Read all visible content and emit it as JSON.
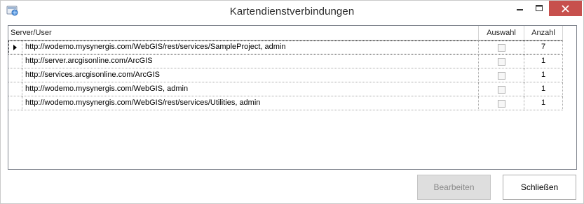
{
  "window": {
    "title": "Kartendienstverbindungen",
    "close_color": "#c7504d"
  },
  "grid": {
    "columns": [
      "Server/User",
      "Auswahl",
      "Anzahl"
    ],
    "rows": [
      {
        "server": "http://wodemo.mysynergis.com/WebGIS/rest/services/SampleProject, admin",
        "selected": false,
        "count": "7",
        "current": true
      },
      {
        "server": "http://server.arcgisonline.com/ArcGIS",
        "selected": false,
        "count": "1",
        "current": false
      },
      {
        "server": "http://services.arcgisonline.com/ArcGIS",
        "selected": false,
        "count": "1",
        "current": false
      },
      {
        "server": "http://wodemo.mysynergis.com/WebGIS, admin",
        "selected": false,
        "count": "1",
        "current": false
      },
      {
        "server": "http://wodemo.mysynergis.com/WebGIS/rest/services/Utilities, admin",
        "selected": false,
        "count": "1",
        "current": false
      }
    ]
  },
  "buttons": {
    "edit_label": "Bearbeiten",
    "close_label": "Schließen"
  }
}
